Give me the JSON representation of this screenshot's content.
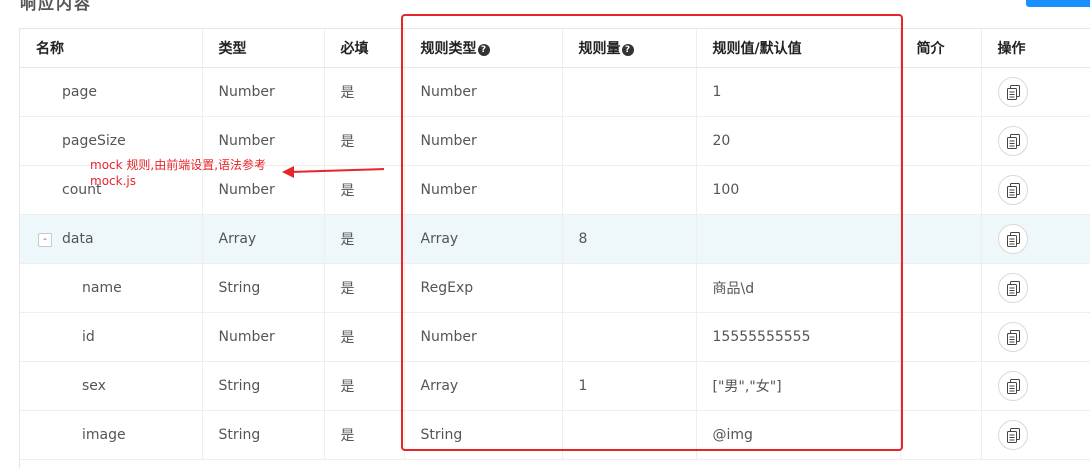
{
  "page": {
    "heading": "响应内容"
  },
  "columns": {
    "name": "名称",
    "type": "类型",
    "required": "必填",
    "rule_type": "规则类型",
    "rule_amount": "规则量",
    "rule_value": "规则值/默认值",
    "description": "简介",
    "action": "操作"
  },
  "rows": [
    {
      "name": "page",
      "type": "Number",
      "required": "是",
      "rule_type": "Number",
      "rule_amount": "",
      "rule_value": "1",
      "description": ""
    },
    {
      "name": "pageSize",
      "type": "Number",
      "required": "是",
      "rule_type": "Number",
      "rule_amount": "",
      "rule_value": "20",
      "description": ""
    },
    {
      "name": "count",
      "type": "Number",
      "required": "是",
      "rule_type": "Number",
      "rule_amount": "",
      "rule_value": "100",
      "description": ""
    },
    {
      "name": "data",
      "type": "Array",
      "required": "是",
      "rule_type": "Array",
      "rule_amount": "8",
      "rule_value": "",
      "description": "",
      "expand_symbol": "-"
    },
    {
      "name": "name",
      "type": "String",
      "required": "是",
      "rule_type": "RegExp",
      "rule_amount": "",
      "rule_value": "商品\\d",
      "description": ""
    },
    {
      "name": "id",
      "type": "Number",
      "required": "是",
      "rule_type": "Number",
      "rule_amount": "",
      "rule_value": "15555555555",
      "description": ""
    },
    {
      "name": "sex",
      "type": "String",
      "required": "是",
      "rule_type": "Array",
      "rule_amount": "1",
      "rule_value": "[\"男\",\"女\"]",
      "description": ""
    },
    {
      "name": "image",
      "type": "String",
      "required": "是",
      "rule_type": "String",
      "rule_amount": "",
      "rule_value": "@img",
      "description": ""
    }
  ],
  "annotation": {
    "line1": "mock 规则,由前端设置,语法参考",
    "line2": "mock.js",
    "color": "#e8242a"
  },
  "icons": {
    "help": "?",
    "copy": "copy-icon"
  },
  "colors": {
    "highlight_row": "#eef8fb",
    "annotation_red": "#e8242a",
    "primary_button": "#1890ff"
  }
}
